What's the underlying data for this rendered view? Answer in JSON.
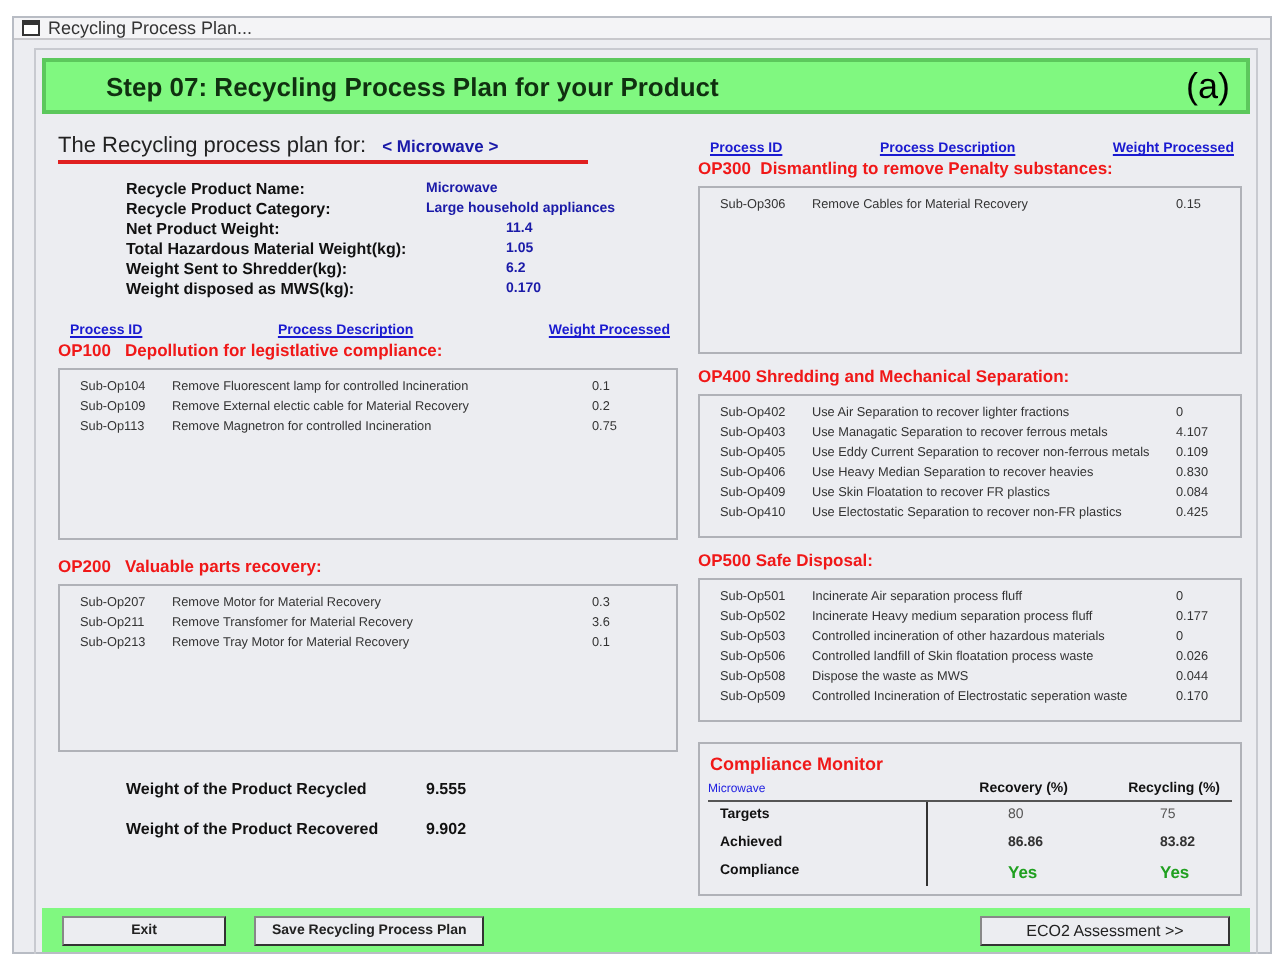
{
  "window": {
    "title": "Recycling Process Plan..."
  },
  "header": {
    "title": "Step 07: Recycling Process Plan for your Product",
    "tag": "(a)"
  },
  "plan_for": {
    "label": "The Recycling process plan for:",
    "product": "< Microwave >"
  },
  "info": [
    {
      "label": "Recycle Product Name:",
      "value": "Microwave",
      "kind": "text"
    },
    {
      "label": "Recycle Product Category:",
      "value": "Large household appliances",
      "kind": "text"
    },
    {
      "label": "Net Product Weight:",
      "value": "11.4",
      "kind": "number"
    },
    {
      "label": "Total Hazardous Material Weight(kg):",
      "value": "1.05",
      "kind": "number"
    },
    {
      "label": "Weight Sent to Shredder(kg):",
      "value": "6.2",
      "kind": "number"
    },
    {
      "label": "Weight disposed as MWS(kg):",
      "value": "0.170",
      "kind": "number"
    }
  ],
  "left_columns": [
    "Process ID",
    "Process Description",
    "Weight Processed"
  ],
  "right_columns": [
    "Process ID",
    "Process Description",
    "Weight Processed"
  ],
  "left_sections": [
    {
      "title": "OP100   Depollution for legistlative compliance:",
      "rows": [
        {
          "id": "Sub-Op104",
          "description": "Remove Fluorescent lamp for controlled Incineration",
          "weight": "0.1"
        },
        {
          "id": "Sub-Op109",
          "description": "Remove External electic cable for Material Recovery",
          "weight": "0.2"
        },
        {
          "id": "Sub-Op113",
          "description": "Remove Magnetron for controlled Incineration",
          "weight": "0.75"
        }
      ]
    },
    {
      "title": "OP200   Valuable parts recovery:",
      "rows": [
        {
          "id": "Sub-Op207",
          "description": "Remove Motor for Material Recovery",
          "weight": "0.3"
        },
        {
          "id": "Sub-Op211",
          "description": "Remove Transfomer for Material Recovery",
          "weight": "3.6"
        },
        {
          "id": "Sub-Op213",
          "description": "Remove Tray Motor for Material Recovery",
          "weight": "0.1"
        }
      ]
    }
  ],
  "right_sections": [
    {
      "title": "OP300  Dismantling to remove Penalty substances:",
      "rows": [
        {
          "id": "Sub-Op306",
          "description": "Remove Cables for Material Recovery",
          "weight": "0.15"
        }
      ]
    },
    {
      "title": "OP400 Shredding and Mechanical Separation:",
      "rows": [
        {
          "id": "Sub-Op402",
          "description": "Use Air Separation to recover lighter fractions",
          "weight": "0"
        },
        {
          "id": "Sub-Op403",
          "description": "Use Managatic Separation to recover ferrous metals",
          "weight": "4.107"
        },
        {
          "id": "Sub-Op405",
          "description": "Use Eddy Current Separation to recover non-ferrous metals",
          "weight": "0.109"
        },
        {
          "id": "Sub-Op406",
          "description": "Use Heavy Median Separation to recover heavies",
          "weight": "0.830"
        },
        {
          "id": "Sub-Op409",
          "description": "Use Skin Floatation to recover FR plastics",
          "weight": "0.084"
        },
        {
          "id": "Sub-Op410",
          "description": "Use Electostatic Separation to recover non-FR plastics",
          "weight": "0.425"
        }
      ]
    },
    {
      "title": "OP500 Safe Disposal:",
      "rows": [
        {
          "id": "Sub-Op501",
          "description": "Incinerate Air separation process fluff",
          "weight": "0"
        },
        {
          "id": "Sub-Op502",
          "description": "Incinerate Heavy medium separation process fluff",
          "weight": "0.177"
        },
        {
          "id": "Sub-Op503",
          "description": "Controlled incineration of other hazardous materials",
          "weight": "0"
        },
        {
          "id": "Sub-Op506",
          "description": "Controlled landfill of Skin floatation process waste",
          "weight": "0.026"
        },
        {
          "id": "Sub-Op508",
          "description": "Dispose the waste as MWS",
          "weight": "0.044"
        },
        {
          "id": "Sub-Op509",
          "description": "Controlled Incineration of Electrostatic seperation waste",
          "weight": "0.170"
        }
      ]
    }
  ],
  "totals": [
    {
      "label": "Weight of the Product Recycled",
      "value": "9.555"
    },
    {
      "label": "Weight of the Product Recovered",
      "value": "9.902"
    }
  ],
  "compliance": {
    "title": "Compliance Monitor",
    "product": "Microwave",
    "columns": [
      "Recovery (%)",
      "Recycling (%)"
    ],
    "rows": [
      {
        "label": "Targets",
        "values": [
          "80",
          "75"
        ],
        "kind": "plain"
      },
      {
        "label": "Achieved",
        "values": [
          "86.86",
          "83.82"
        ],
        "kind": "bold"
      },
      {
        "label": "Compliance",
        "values": [
          "Yes",
          "Yes"
        ],
        "kind": "verdict"
      }
    ]
  },
  "buttons": {
    "left": [
      "Exit",
      "Save Recycling Process Plan"
    ],
    "right": "ECO2 Assessment >>"
  }
}
